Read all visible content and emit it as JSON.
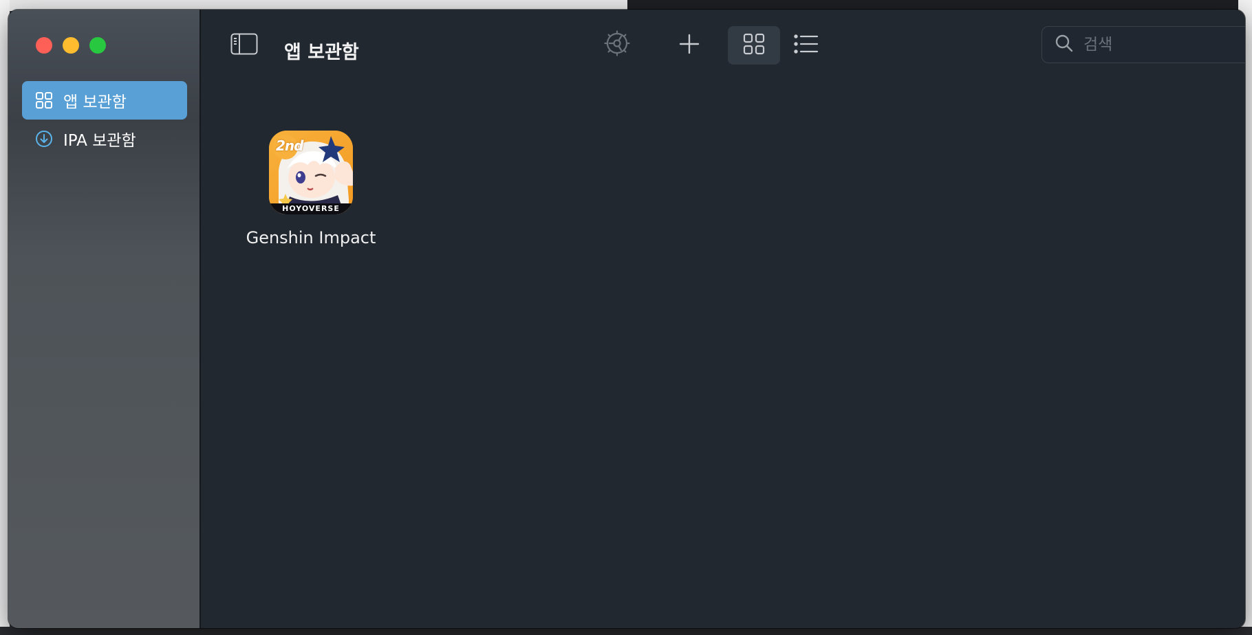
{
  "window": {
    "title": "앱 보관함"
  },
  "sidebar": {
    "items": [
      {
        "label": "앱 보관함",
        "icon": "grid-icon",
        "selected": true
      },
      {
        "label": "IPA 보관함",
        "icon": "download-circle-icon",
        "selected": false
      }
    ]
  },
  "toolbar": {
    "settings_icon": "gear-icon",
    "add_icon": "plus-icon",
    "grid_view_icon": "grid-icon",
    "list_view_icon": "list-icon",
    "sidebar_toggle_icon": "sidebar-icon",
    "active_view": "grid"
  },
  "search": {
    "placeholder": "검색",
    "value": ""
  },
  "apps": [
    {
      "name": "Genshin Impact",
      "badge": "2nd",
      "publisher_mark": "HOYOVERSE"
    }
  ],
  "colors": {
    "accent": "#59a0d6",
    "window_bg": "#212830",
    "traffic_red": "#fe5f57",
    "traffic_yellow": "#febc2e",
    "traffic_green": "#28c840"
  }
}
